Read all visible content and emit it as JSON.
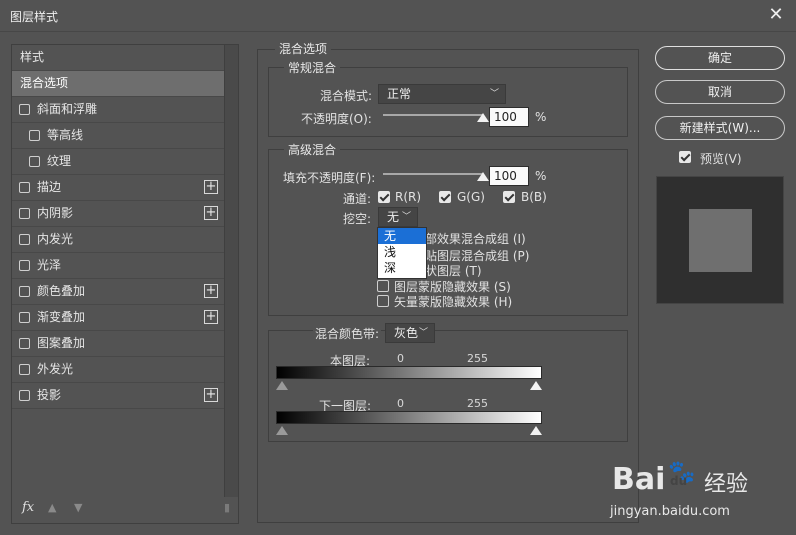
{
  "window": {
    "title": "图层样式",
    "close_glyph": "✕"
  },
  "left": {
    "header": "样式",
    "items": [
      {
        "label": "混合选项",
        "selected": true,
        "checkbox": false,
        "indent": false,
        "plus": false
      },
      {
        "label": "斜面和浮雕",
        "checkbox": true,
        "indent": false,
        "plus": false
      },
      {
        "label": "等高线",
        "checkbox": true,
        "indent": true,
        "plus": false
      },
      {
        "label": "纹理",
        "checkbox": true,
        "indent": true,
        "plus": false
      },
      {
        "label": "描边",
        "checkbox": true,
        "indent": false,
        "plus": true
      },
      {
        "label": "内阴影",
        "checkbox": true,
        "indent": false,
        "plus": true
      },
      {
        "label": "内发光",
        "checkbox": true,
        "indent": false,
        "plus": false
      },
      {
        "label": "光泽",
        "checkbox": true,
        "indent": false,
        "plus": false
      },
      {
        "label": "颜色叠加",
        "checkbox": true,
        "indent": false,
        "plus": true
      },
      {
        "label": "渐变叠加",
        "checkbox": true,
        "indent": false,
        "plus": true
      },
      {
        "label": "图案叠加",
        "checkbox": true,
        "indent": false,
        "plus": false
      },
      {
        "label": "外发光",
        "checkbox": true,
        "indent": false,
        "plus": false
      },
      {
        "label": "投影",
        "checkbox": true,
        "indent": false,
        "plus": true
      }
    ],
    "footer": {
      "fx": "fx",
      "plus_glyph": "+"
    }
  },
  "blend": {
    "title": "混合选项",
    "general": {
      "title": "常规混合",
      "mode_label": "混合模式:",
      "mode_value": "正常",
      "opacity_label": "不透明度(O):",
      "opacity_value": "100",
      "opacity_unit": "%",
      "opacity_level": 1.0
    },
    "advanced": {
      "title": "高级混合",
      "fill_label": "填充不透明度(F):",
      "fill_value": "100",
      "fill_unit": "%",
      "fill_level": 1.0,
      "channels_label": "通道:",
      "channels": [
        "R(R)",
        "G(G)",
        "B(B)"
      ],
      "knockout_label": "挖空:",
      "knockout_value": "无",
      "knockout_options": [
        "无",
        "浅",
        "深"
      ],
      "options": [
        {
          "label": "将内部效果混合成组 (I)",
          "visible": "部效果混合成组 (I)",
          "checked": false
        },
        {
          "label": "将剪贴图层混合成组 (P)",
          "visible": "贴图层混合成组 (P)",
          "checked": true
        },
        {
          "label": "透明形状图层 (T)",
          "visible": "状图层 (T)",
          "checked": true
        },
        {
          "label": "图层蒙版隐藏效果 (S)",
          "visible": "图层蒙版隐藏效果 (S)",
          "checked": false
        },
        {
          "label": "矢量蒙版隐藏效果 (H)",
          "visible": "矢量蒙版隐藏效果 (H)",
          "checked": false
        }
      ]
    },
    "blend_if": {
      "label": "混合颜色带:",
      "value": "灰色",
      "this_layer": {
        "label": "本图层:",
        "min": "0",
        "max": "255"
      },
      "underlying": {
        "label": "下一图层:",
        "min": "0",
        "max": "255"
      }
    }
  },
  "buttons": {
    "ok": "确定",
    "cancel": "取消",
    "new_style": "新建样式(W)..."
  },
  "preview": {
    "label": "预览(V)",
    "checked": true
  },
  "watermark": {
    "brand": "Bai",
    "du_glyph": "du",
    "cn": "经验",
    "url": "jingyan.baidu.com"
  }
}
